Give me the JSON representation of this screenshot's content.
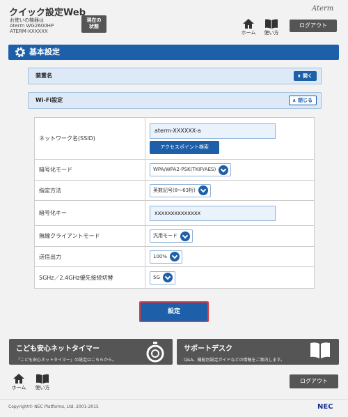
{
  "header": {
    "title": "クイック設定Web",
    "model_lines": [
      "お使いの機器は",
      "Aterm WG2600HP",
      "ATERM-XXXXXX"
    ],
    "status_button": "現在の\n状態",
    "brand": "Aterm",
    "home_label": "ホーム",
    "howto_label": "使い方",
    "logout": "ログアウト"
  },
  "section_title": "基本設定",
  "panels": {
    "device_name": {
      "label": "装置名",
      "button": "開く"
    },
    "wifi": {
      "label": "Wi-Fi設定",
      "button": "閉じる"
    }
  },
  "wifi": {
    "ssid_label": "ネットワーク名(SSID)",
    "ssid_value": "aterm-XXXXXX-a",
    "ap_search": "アクセスポイント検索",
    "encryption_label": "暗号化モード",
    "encryption_value": "WPA/WPA2-PSK(TKIP/AES)",
    "method_label": "指定方法",
    "method_value": "英数記号(8〜63桁)",
    "key_label": "暗号化キー",
    "key_value": "xxxxxxxxxxxxxx",
    "client_mode_label": "無線クライアントモード",
    "client_mode_value": "汎用モード",
    "power_label": "送信出力",
    "power_value": "100%",
    "band_label": "5GHz／2.4GHz優先接続切替",
    "band_value": "5G"
  },
  "submit": "設定",
  "banners": {
    "timer_title": "こども安心ネットタイマー",
    "timer_sub": "「こども安心ネットタイマー」の設定はこちらから。",
    "support_title": "サポートデスク",
    "support_sub": "Q&A、機能別設定ガイドなどの情報をご案内します。"
  },
  "footer": {
    "home_label": "ホーム",
    "howto_label": "使い方",
    "logout": "ログアウト",
    "copyright": "Copyright© NEC Platforms, Ltd. 2001-2015",
    "nec": "NEC"
  },
  "colors": {
    "accent": "#1d5fa8",
    "dark_button": "#555555",
    "highlight": "#e0393e"
  }
}
